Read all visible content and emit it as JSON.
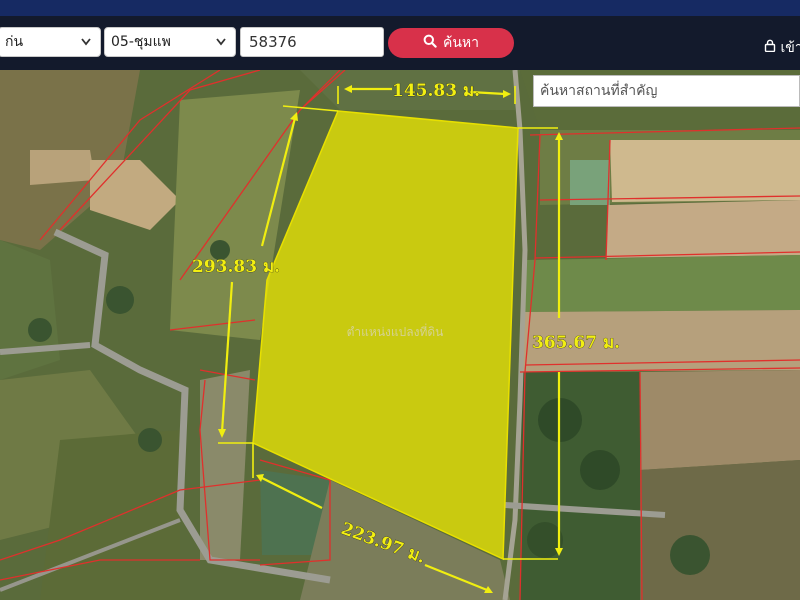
{
  "header": {
    "province_value": "ก่น",
    "district_value": "05-ชุมแพ",
    "parcel_number": "58376",
    "search_label": "ค้นหา",
    "login_label": "เข้า"
  },
  "map": {
    "place_search_placeholder": "ค้นหาสถานที่สำคัญ",
    "parcel_label": "ตำแหน่งแปลงที่ดิน",
    "dimensions": {
      "top": "145.83 ม.",
      "left": "293.83 ม.",
      "right": "365.67 ม.",
      "bottom": "223.97 ม."
    }
  },
  "colors": {
    "topbar": "#162a63",
    "toolbar": "#131a2c",
    "search_button": "#d8314a",
    "parcel_fill": "#f4ee00",
    "boundary": "#e0302c",
    "dimension_text": "#f2ef12"
  },
  "icons": [
    "chevron-down-icon",
    "search-icon",
    "lock-icon"
  ]
}
